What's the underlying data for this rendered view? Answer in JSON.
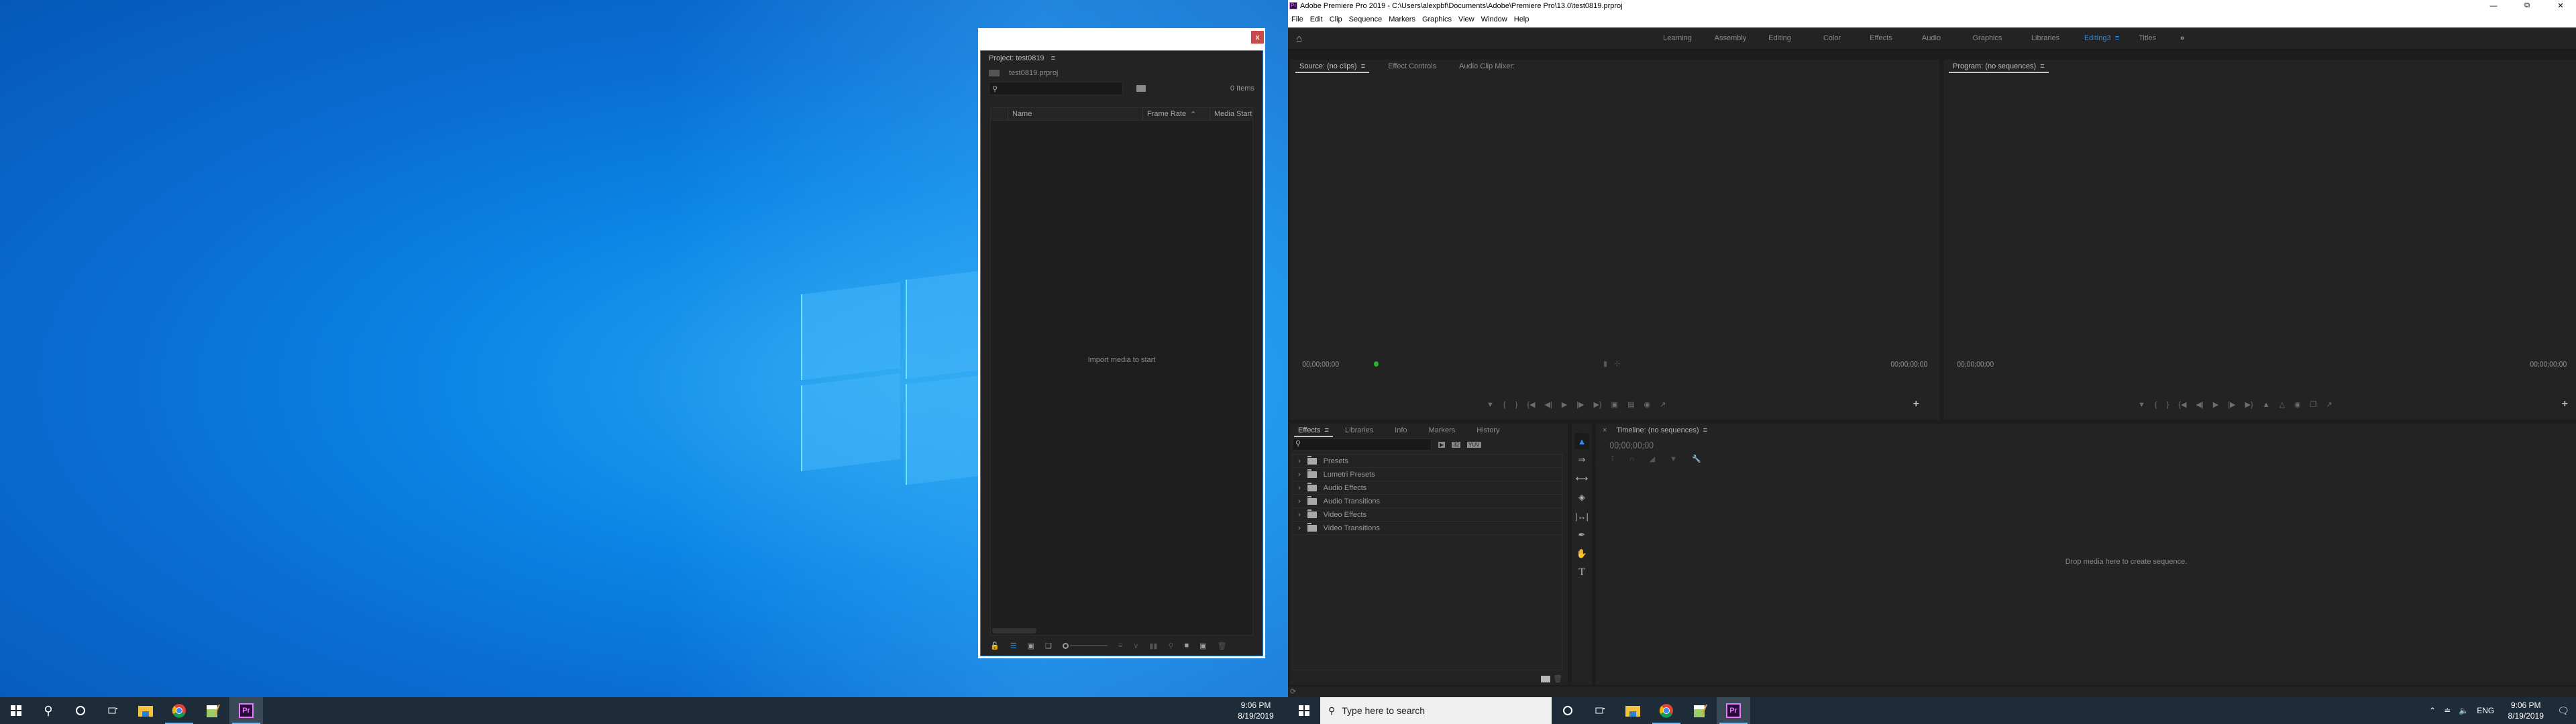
{
  "desktop": {
    "taskbar_left": {
      "apps": [
        {
          "name": "file-explorer",
          "active": false
        },
        {
          "name": "chrome",
          "active": false
        },
        {
          "name": "notepad-plus-plus",
          "active": false
        },
        {
          "name": "premiere-pro",
          "label": "Pr",
          "active": true
        }
      ],
      "clock_time": "9:06 PM",
      "clock_date": "8/19/2019"
    },
    "taskbar_right": {
      "search_placeholder": "Type here to search",
      "lang": "ENG",
      "clock_time": "9:06 PM",
      "clock_date": "8/19/2019",
      "premiere_label": "Pr"
    }
  },
  "project_window": {
    "close_label": "x",
    "panel_title": "Project: test0819",
    "menu_icon": "≡",
    "bin_path": "test0819.prproj",
    "search_placeholder": "",
    "item_count": "0 Items",
    "columns": [
      "Name",
      "Frame Rate",
      "Media Start"
    ],
    "sort_indicator": "^",
    "empty_message": "Import media to start"
  },
  "premiere": {
    "app_icon": "Pr",
    "title": "Adobe Premiere Pro 2019 - C:\\Users\\alexpbf\\Documents\\Adobe\\Premiere Pro\\13.0\\test0819.prproj",
    "menu": [
      "File",
      "Edit",
      "Clip",
      "Sequence",
      "Markers",
      "Graphics",
      "View",
      "Window",
      "Help"
    ],
    "workspaces": [
      "Learning",
      "Assembly",
      "Editing",
      "Color",
      "Effects",
      "Audio",
      "Graphics",
      "Libraries",
      "Editing3",
      "Titles"
    ],
    "active_workspace": "Editing3",
    "overflow": "»",
    "source_monitor": {
      "tabs": [
        "Source: (no clips)",
        "Effect Controls",
        "Audio Clip Mixer:"
      ],
      "timecode_left": "00;00;00;00",
      "timecode_right": "00;00;00;00"
    },
    "program_monitor": {
      "tab": "Program: (no sequences)",
      "timecode_left": "00;00;00;00",
      "timecode_right": "00;00;00;00"
    },
    "effects_panel": {
      "tabs": [
        "Effects",
        "Libraries",
        "Info",
        "Markers",
        "History"
      ],
      "filter_badges": [
        "▶",
        "32",
        "YUV"
      ],
      "items": [
        "Presets",
        "Lumetri Presets",
        "Audio Effects",
        "Audio Transitions",
        "Video Effects",
        "Video Transitions"
      ]
    },
    "timeline": {
      "tab": "Timeline: (no sequences)",
      "close": "×",
      "timecode": "00;00;00;00",
      "empty_message": "Drop media here to create sequence."
    },
    "accent_color": "#2d8ceb"
  }
}
